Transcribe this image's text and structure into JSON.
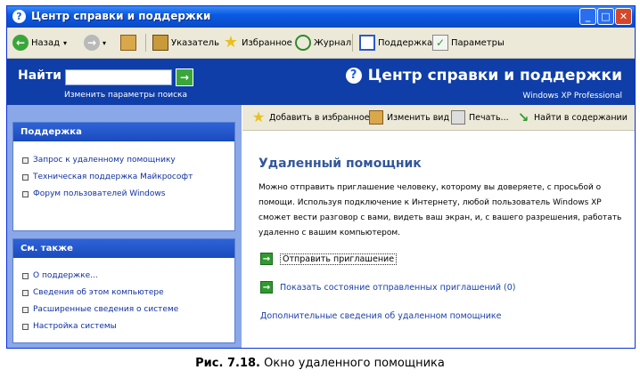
{
  "window": {
    "title": "Центр справки и поддержки",
    "controls": {
      "minimize": "_",
      "maximize": "□",
      "close": "✕"
    }
  },
  "navbar": {
    "back": "Назад",
    "index": "Указатель",
    "favorites": "Избранное",
    "history": "Журнал",
    "support": "Поддержка",
    "options": "Параметры"
  },
  "search": {
    "label": "Найти",
    "value": "",
    "options_link": "Изменить параметры поиска",
    "brand": "Центр справки и поддержки",
    "os": "Windows XP Professional"
  },
  "left_panel": {
    "support_box": {
      "header": "Поддержка",
      "items": [
        "Запрос к удаленному помощнику",
        "Техническая поддержка Майкрософт",
        "Форум пользователей Windows"
      ]
    },
    "see_also_box": {
      "header": "См. также",
      "items": [
        "О поддержке...",
        "Сведения об этом компьютере",
        "Расширенные сведения о системе",
        "Настройка системы"
      ]
    }
  },
  "content_toolbar": {
    "add_fav": "Добавить в избранное",
    "change_view": "Изменить вид",
    "print": "Печать...",
    "find_contents": "Найти в содержании"
  },
  "content": {
    "title": "Удаленный помощник",
    "paragraph": "Можно отправить приглашение человеку, которому вы доверяете, с просьбой о помощи. Используя подключение к Интернету, любой пользователь Windows XP сможет вести разговор с вами, видеть ваш экран, и, с вашего разрешения, работать удаленно с вашим компьютером.",
    "send_invite": "Отправить приглашение",
    "show_status": "Показать состояние отправленных приглашений (0)",
    "more_info": "Дополнительные сведения об удаленном помощнике"
  },
  "caption": {
    "bold": "Рис. 7.18.",
    "text": "Окно удаленного помощника"
  },
  "colors": {
    "titlebar": "#0a5ae3",
    "search_band": "#0f3ea8",
    "left_panel_bg": "#8aa7e8",
    "link": "#1a3fa8",
    "content_title": "#33579b"
  }
}
